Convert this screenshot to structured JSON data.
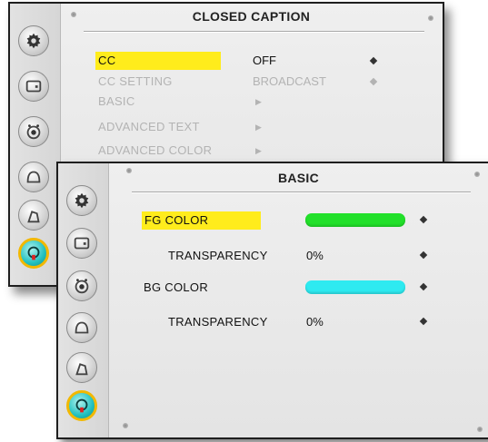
{
  "closed_caption": {
    "title": "CLOSED CAPTION",
    "items": [
      {
        "label": "CC",
        "value": "OFF"
      },
      {
        "label": "CC SETTING",
        "value": "BROADCAST"
      },
      {
        "label": "BASIC"
      },
      {
        "label": "ADVANCED TEXT"
      },
      {
        "label": "ADVANCED COLOR"
      }
    ]
  },
  "basic": {
    "title": "BASIC",
    "fg_color": {
      "label": "FG COLOR",
      "color": "#22e02a"
    },
    "fg_transparency": {
      "label": "TRANSPARENCY",
      "value": "0%"
    },
    "bg_color": {
      "label": "BG COLOR",
      "color": "#2eeaf0"
    },
    "bg_transparency": {
      "label": "TRANSPARENCY",
      "value": "0%"
    }
  },
  "colors": {
    "highlight": "#ffec1c",
    "accent_active": "#22c1c0"
  },
  "sidebar_icons": [
    "settings-icon",
    "picture-icon",
    "audio-icon",
    "monitor-icon",
    "lock-icon",
    "caption-icon"
  ]
}
